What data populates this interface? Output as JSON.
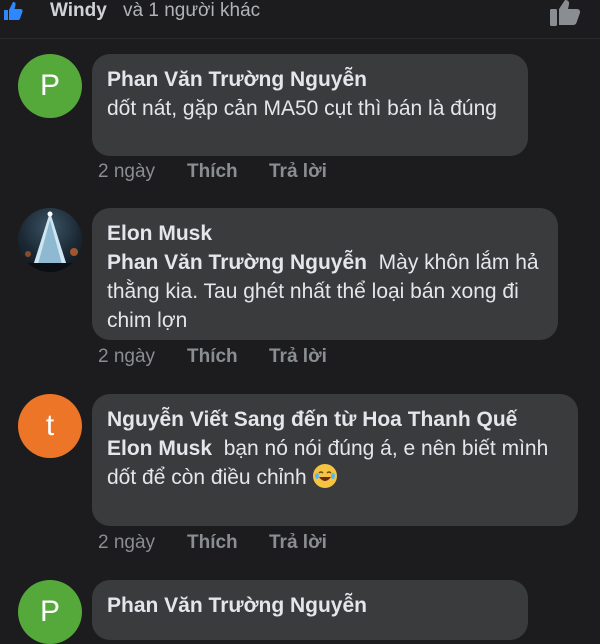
{
  "reactions": {
    "liker": "Windy",
    "others": "và 1 người khác"
  },
  "comments": [
    {
      "avatar_letter": "P",
      "author": "Phan Văn Trường Nguyễn",
      "text": "dốt nát, gặp cản MA50 cụt thì bán là đúng",
      "time": "2 ngày",
      "like": "Thích",
      "reply": "Trả lời"
    },
    {
      "author": "Elon Musk",
      "mention": "Phan Văn Trường Nguyễn",
      "text": "Mày khôn lắm hả thằng kia. Tau ghét nhất thể loại bán xong đi chim lợn",
      "time": "2 ngày",
      "like": "Thích",
      "reply": "Trả lời"
    },
    {
      "avatar_letter": "t",
      "author": "Nguyễn Viết Sang đến từ Hoa Thanh Quế",
      "mention": "Elon Musk",
      "text": "bạn nó nói đúng á, e nên biết mình dốt để còn điều chỉnh",
      "emoji": "laughing-tears-emoji",
      "time": "2 ngày",
      "like": "Thích",
      "reply": "Trả lời"
    },
    {
      "avatar_letter": "P",
      "author": "Phan Văn Trường Nguyễn"
    }
  ],
  "colors": {
    "background": "#1c1c1e",
    "bubble": "#3a3b3c",
    "like_blue": "#2d88ff",
    "avatar_green": "#55a93a",
    "avatar_orange": "#ed7528"
  },
  "icons": [
    "like-badge-icon",
    "thumbs-up-icon",
    "laughing-tears-emoji"
  ]
}
